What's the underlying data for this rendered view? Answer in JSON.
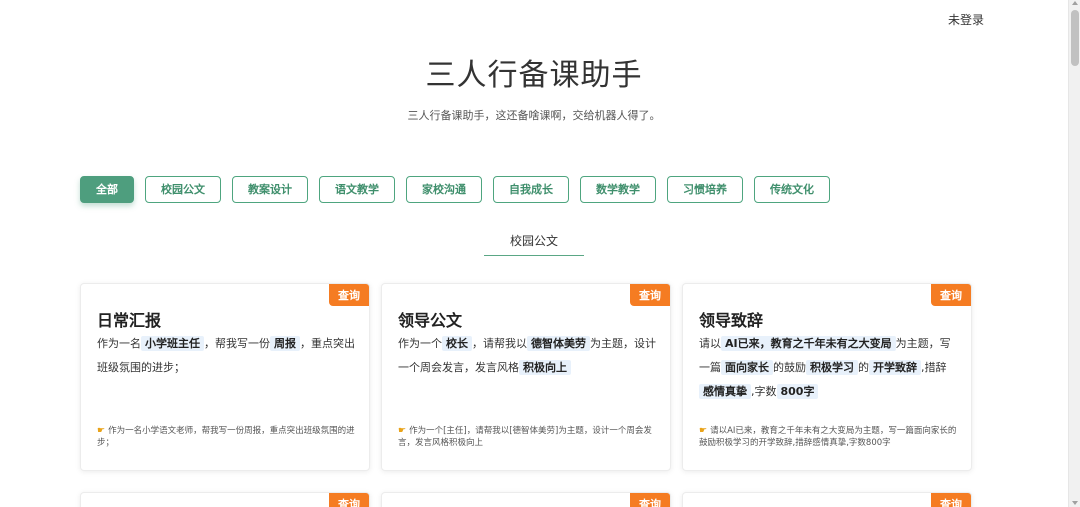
{
  "header": {
    "login_status": "未登录"
  },
  "page": {
    "title": "三人行备课助手",
    "subtitle": "三人行备课助手，这还备啥课啊，交给机器人得了。"
  },
  "filters": [
    {
      "label": "全部",
      "active": true
    },
    {
      "label": "校园公文",
      "active": false
    },
    {
      "label": "教案设计",
      "active": false
    },
    {
      "label": "语文教学",
      "active": false
    },
    {
      "label": "家校沟通",
      "active": false
    },
    {
      "label": "自我成长",
      "active": false
    },
    {
      "label": "数学教学",
      "active": false
    },
    {
      "label": "习惯培养",
      "active": false
    },
    {
      "label": "传统文化",
      "active": false
    }
  ],
  "section": {
    "title": "校园公文"
  },
  "cards": [
    {
      "tag": "查询",
      "title": "日常汇报",
      "body": [
        {
          "t": "作为一名",
          "hl": false
        },
        {
          "t": "小学班主任",
          "hl": true
        },
        {
          "t": "，帮我写一份",
          "hl": false
        },
        {
          "t": "周报",
          "hl": true
        },
        {
          "t": "，重点突出班级氛围的进步；",
          "hl": false
        }
      ],
      "example": "作为一名小学语文老师，帮我写一份周报，重点突出班级氛围的进步；"
    },
    {
      "tag": "查询",
      "title": "领导公文",
      "body": [
        {
          "t": "作为一个",
          "hl": false
        },
        {
          "t": "校长",
          "hl": true
        },
        {
          "t": "，请帮我以",
          "hl": false
        },
        {
          "t": "德智体美劳",
          "hl": true
        },
        {
          "t": "为主题，设计一个周会发言，发言风格",
          "hl": false
        },
        {
          "t": "积极向上",
          "hl": true
        }
      ],
      "example": "作为一个[主任]，请帮我以[德智体美劳]为主题，设计一个周会发言，发言风格积极向上"
    },
    {
      "tag": "查询",
      "title": "领导致辞",
      "body": [
        {
          "t": "请以",
          "hl": false
        },
        {
          "t": "AI已来，教育之千年未有之大变局",
          "hl": true
        },
        {
          "t": "为主题，写一篇",
          "hl": false
        },
        {
          "t": "面向家长",
          "hl": true
        },
        {
          "t": "的鼓励",
          "hl": false
        },
        {
          "t": "积极学习",
          "hl": true
        },
        {
          "t": "的",
          "hl": false
        },
        {
          "t": "开学致辞",
          "hl": true
        },
        {
          "t": ",措辞",
          "hl": false
        },
        {
          "t": "感情真挚",
          "hl": true
        },
        {
          "t": ",字数",
          "hl": false
        },
        {
          "t": "800字",
          "hl": true
        }
      ],
      "example": "请以AI已来，教育之千年未有之大变局为主题，写一篇面向家长的鼓励积极学习的开学致辞,措辞感情真挚,字数800字"
    }
  ],
  "bottom_cards": [
    {
      "tag": "查询"
    },
    {
      "tag": "查询"
    },
    {
      "tag": "查询"
    }
  ],
  "icons": {
    "example_icon": "pointing-hand-icon"
  },
  "colors": {
    "accent": "#4e9e7e",
    "tag": "#f57c22",
    "highlight_bg": "#e8f1fb"
  }
}
